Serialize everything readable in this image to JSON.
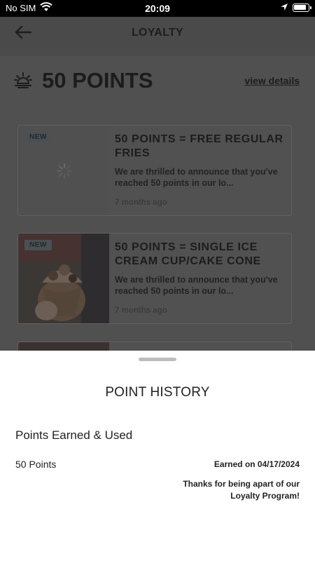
{
  "status_bar": {
    "carrier": "No SIM",
    "time": "20:09"
  },
  "header": {
    "title": "LOYALTY"
  },
  "points": {
    "value": "50 POINTS",
    "view_details": "view details"
  },
  "cards": [
    {
      "badge": "NEW",
      "title": "50 POINTS = FREE REGULAR FRIES",
      "description": "We are thrilled to announce that you've reached 50 points in our lo...",
      "time": "7 months ago"
    },
    {
      "badge": "NEW",
      "title": "50 POINTS = SINGLE ICE CREAM CUP/CAKE CONE",
      "description": "We are thrilled to announce that you've reached 50 points in our lo...",
      "time": "7 months ago"
    }
  ],
  "sheet": {
    "title": "POINT HISTORY",
    "section_title": "Points Earned & Used",
    "entries": [
      {
        "points": "50 Points",
        "date": "Earned on 04/17/2024",
        "note": "Thanks for being apart of our Loyalty Program!"
      }
    ]
  }
}
